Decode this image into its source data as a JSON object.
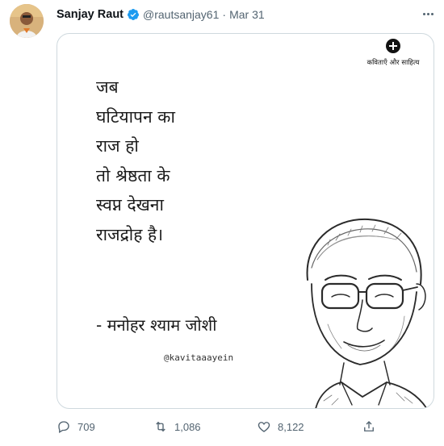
{
  "tweet": {
    "display_name": "Sanjay Raut",
    "handle": "@rautsanjay61",
    "separator": "·",
    "date": "Mar 31",
    "verified": true,
    "avatar_icon": "profile-photo"
  },
  "media": {
    "brand_name": "कविताएँ और साहित्य",
    "poem_lines": [
      "जब",
      "घटियापन का",
      "राज हो",
      "तो श्रेष्ठता के",
      "स्वप्न देखना",
      "राजद्रोह है।"
    ],
    "author": "- मनोहर श्याम जोशी",
    "social_handle": "@kavitaaayein"
  },
  "actions": {
    "reply_count": "709",
    "retweet_count": "1,086",
    "like_count": "8,122"
  },
  "colors": {
    "verified_blue": "#1d9bf0",
    "muted_text": "#536471",
    "card_border": "#cfd9de"
  }
}
